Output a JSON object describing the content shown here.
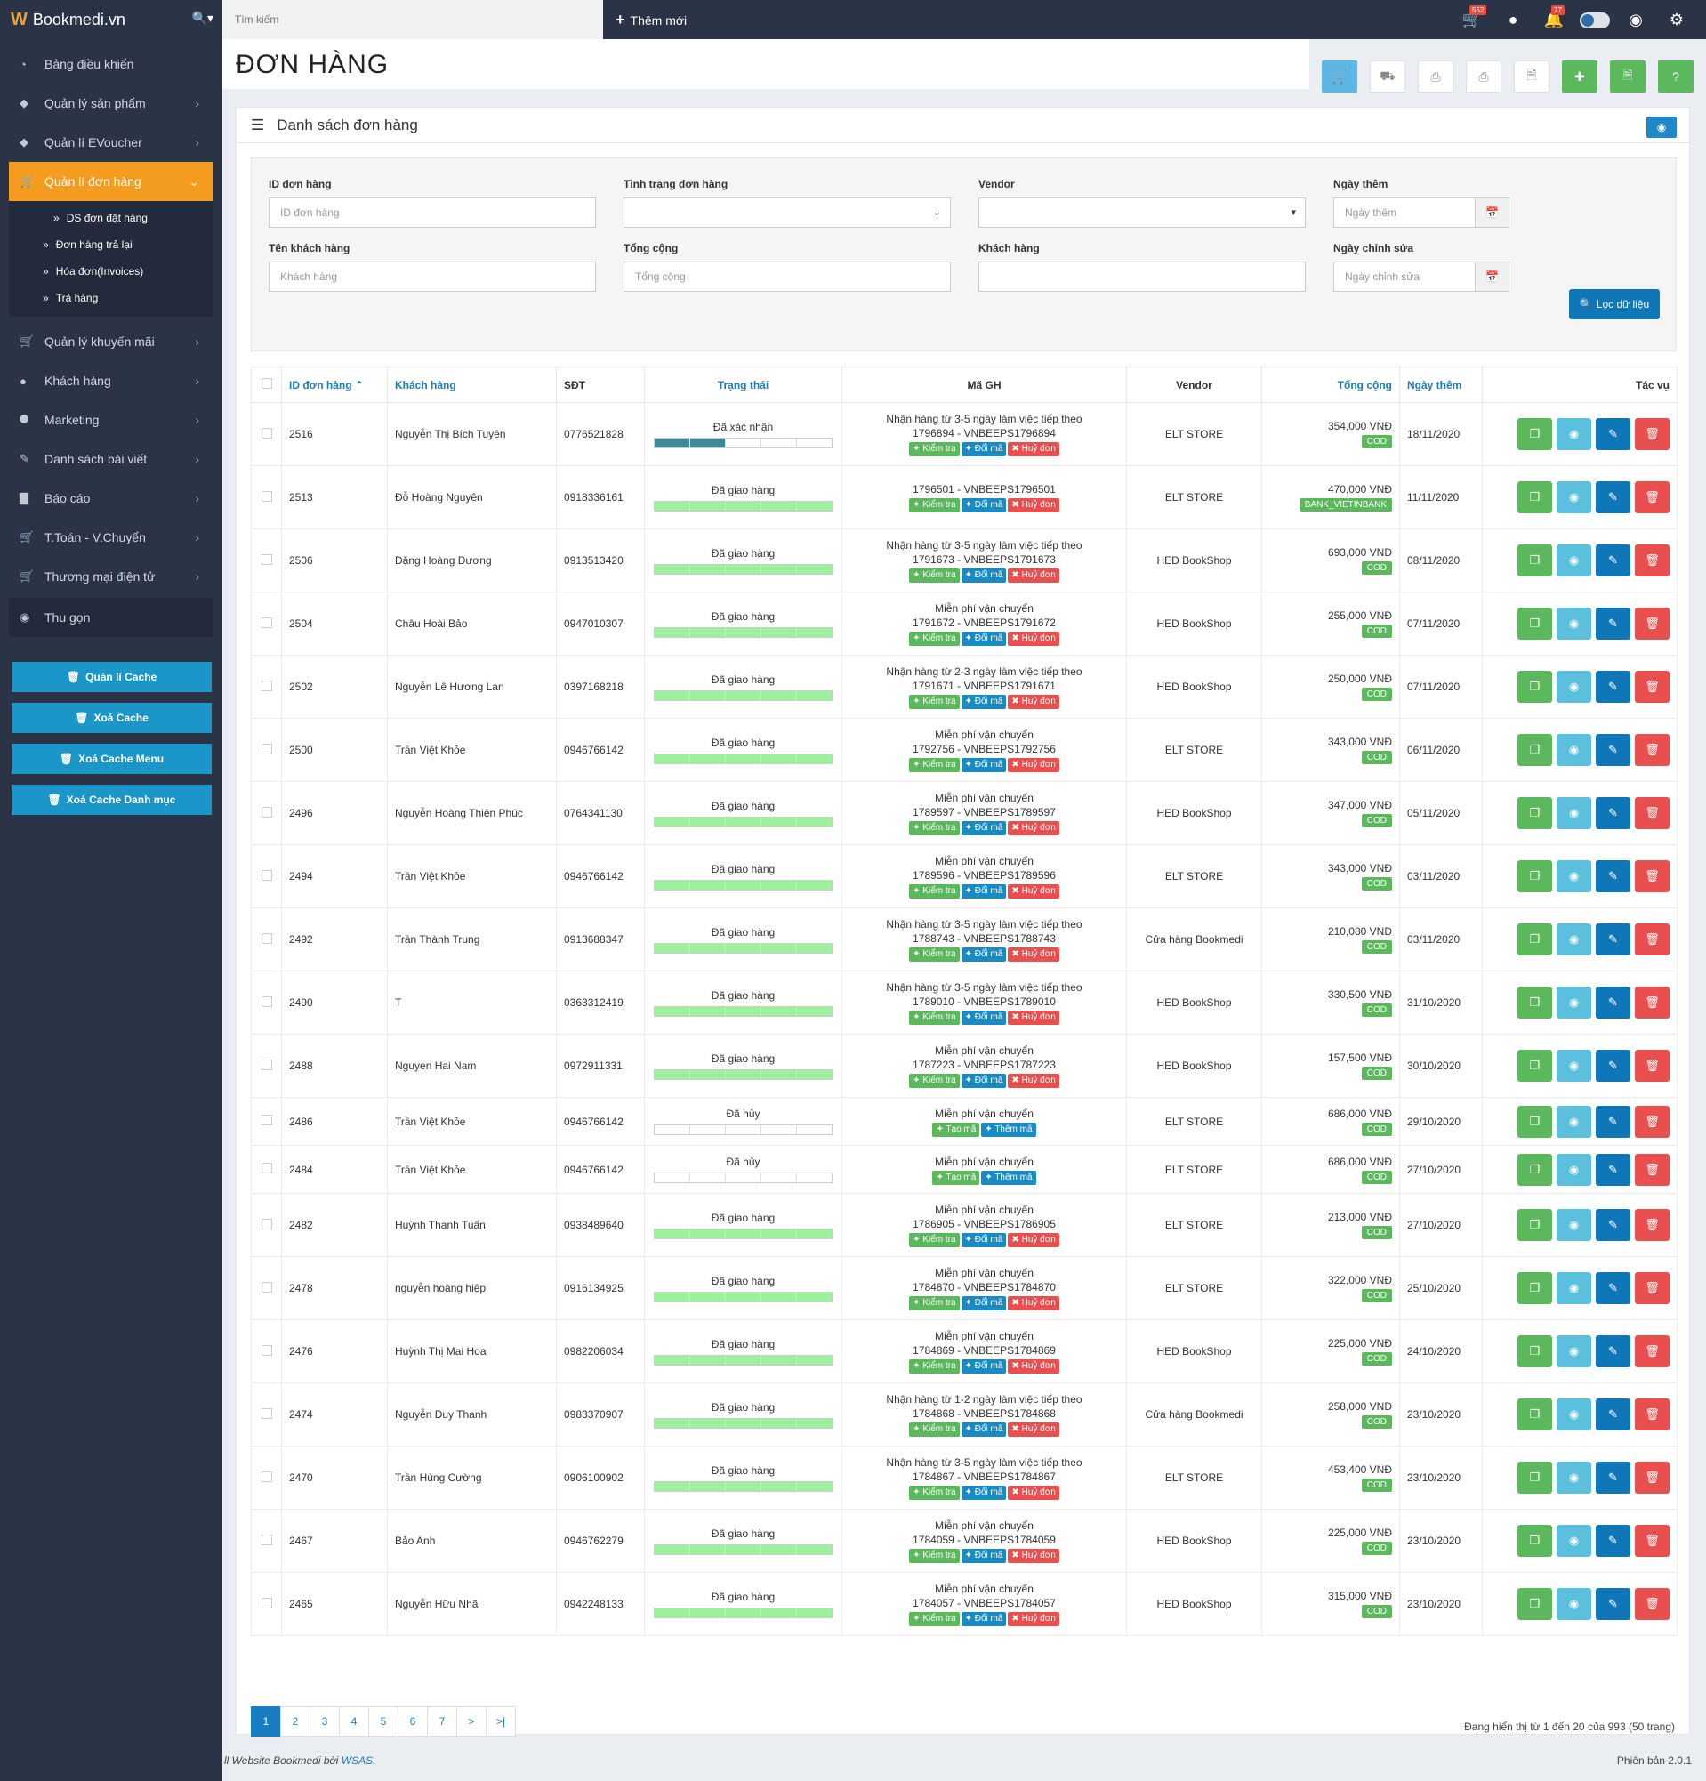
{
  "brand": {
    "name": "Bookmedi.vn"
  },
  "topbar": {
    "search_placeholder": "Tìm kiếm",
    "add_new": "Thêm mới",
    "cart_count": "552",
    "bell_count": "77"
  },
  "sidebar": {
    "items": [
      {
        "label": "Bảng điều khiển",
        "icon": "dashboard-icon"
      },
      {
        "label": "Quản lý sản phẩm",
        "icon": "tags-icon"
      },
      {
        "label": "Quản lí EVoucher",
        "icon": "tags-icon"
      },
      {
        "label": "Quản lí đơn hàng",
        "icon": "cart-icon"
      }
    ],
    "sub": [
      "DS đơn đặt hàng",
      "Đơn hàng trả lại",
      "Hóa đơn(Invoices)",
      "Trả hàng"
    ],
    "items2": [
      {
        "label": "Quản lý khuyến mãi",
        "icon": "cart-icon"
      },
      {
        "label": "Khách hàng",
        "icon": "user-icon"
      },
      {
        "label": "Marketing",
        "icon": "share-icon"
      },
      {
        "label": "Danh sách bài viết",
        "icon": "pencil-icon"
      },
      {
        "label": "Báo cáo",
        "icon": "chart-icon"
      },
      {
        "label": "T.Toán - V.Chuyển",
        "icon": "cart-icon"
      },
      {
        "label": "Thương mại điện tử",
        "icon": "cart-icon"
      }
    ],
    "collapse": "Thu gọn",
    "cache_buttons": [
      "Quản lí Cache",
      "Xoá Cache",
      "Xoá Cache Menu",
      "Xoá Cache Danh mục"
    ]
  },
  "page": {
    "title": "ĐƠN HÀNG",
    "panel_title": "Danh sách đơn hàng"
  },
  "filter": {
    "order_id_label": "ID đơn hàng",
    "order_id_placeholder": "ID đơn hàng",
    "status_label": "Tình trạng đơn hàng",
    "vendor_label": "Vendor",
    "date_added_label": "Ngày thêm",
    "date_added_placeholder": "Ngày thêm",
    "customer_name_label": "Tên khách hàng",
    "customer_name_placeholder": "Khách hàng",
    "total_label": "Tổng cộng",
    "total_placeholder": "Tổng cộng",
    "customer_label": "Khách hàng",
    "date_modified_label": "Ngày chỉnh sửa",
    "date_modified_placeholder": "Ngày chỉnh sửa",
    "button": "Lọc dữ liệu"
  },
  "table": {
    "headers": [
      "ID đơn hàng",
      "Khách hàng",
      "SĐT",
      "Trạng thái",
      "Mã GH",
      "Vendor",
      "Tổng cộng",
      "Ngày thêm",
      "Tác vụ"
    ],
    "btn_check": "Kiểm tra",
    "btn_change": "Đổi mã",
    "btn_cancel": "Huỷ đơn",
    "btn_create": "Tạo mã",
    "btn_add": "Thêm mã",
    "rows": [
      {
        "id": "2516",
        "name": "Nguyễn Thị Bích Tuyền",
        "phone": "0776521828",
        "status": "Đã xác nhận",
        "progress": 0.33,
        "ship_note": "Nhận hàng từ 3-5 ngày làm việc tiếp theo",
        "code": "1796894 - VNBEEPS1796894",
        "vendor": "ELT STORE",
        "total": "354,000 VNĐ",
        "pay": "COD",
        "date": "18/11/2020"
      },
      {
        "id": "2513",
        "name": "Đỗ Hoàng Nguyên",
        "phone": "0918336161",
        "status": "Đã giao hàng",
        "progress": 1,
        "ship_note": "",
        "code": "1796501 - VNBEEPS1796501",
        "vendor": "ELT STORE",
        "total": "470,000 VNĐ",
        "pay": "BANK_VIETINBANK",
        "date": "11/11/2020"
      },
      {
        "id": "2506",
        "name": "Đặng Hoàng Dương",
        "phone": "0913513420",
        "status": "Đã giao hàng",
        "progress": 1,
        "ship_note": "Nhận hàng từ 3-5 ngày làm việc tiếp theo",
        "code": "1791673 - VNBEEPS1791673",
        "vendor": "HED BookShop",
        "total": "693,000 VNĐ",
        "pay": "COD",
        "date": "08/11/2020"
      },
      {
        "id": "2504",
        "name": "Châu Hoài Bảo",
        "phone": "0947010307",
        "status": "Đã giao hàng",
        "progress": 1,
        "ship_note": "Miễn phí vận chuyển",
        "code": "1791672 - VNBEEPS1791672",
        "vendor": "HED BookShop",
        "total": "255,000 VNĐ",
        "pay": "COD",
        "date": "07/11/2020"
      },
      {
        "id": "2502",
        "name": "Nguyễn Lê Hương Lan",
        "phone": "0397168218",
        "status": "Đã giao hàng",
        "progress": 1,
        "ship_note": "Nhận hàng từ 2-3 ngày làm việc tiếp theo",
        "code": "1791671 - VNBEEPS1791671",
        "vendor": "HED BookShop",
        "total": "250,000 VNĐ",
        "pay": "COD",
        "date": "07/11/2020"
      },
      {
        "id": "2500",
        "name": "Trần Việt Khỏe",
        "phone": "0946766142",
        "status": "Đã giao hàng",
        "progress": 1,
        "ship_note": "Miễn phí vận chuyển",
        "code": "1792756 - VNBEEPS1792756",
        "vendor": "ELT STORE",
        "total": "343,000 VNĐ",
        "pay": "COD",
        "date": "06/11/2020"
      },
      {
        "id": "2496",
        "name": "Nguyễn Hoàng Thiên Phúc",
        "phone": "0764341130",
        "status": "Đã giao hàng",
        "progress": 1,
        "ship_note": "Miễn phí vận chuyển",
        "code": "1789597 - VNBEEPS1789597",
        "vendor": "HED BookShop",
        "total": "347,000 VNĐ",
        "pay": "COD",
        "date": "05/11/2020"
      },
      {
        "id": "2494",
        "name": "Trần Việt Khỏe",
        "phone": "0946766142",
        "status": "Đã giao hàng",
        "progress": 1,
        "ship_note": "Miễn phí vận chuyển",
        "code": "1789596 - VNBEEPS1789596",
        "vendor": "ELT STORE",
        "total": "343,000 VNĐ",
        "pay": "COD",
        "date": "03/11/2020"
      },
      {
        "id": "2492",
        "name": "Trần Thành Trung",
        "phone": "0913688347",
        "status": "Đã giao hàng",
        "progress": 1,
        "ship_note": "Nhận hàng từ 3-5 ngày làm việc tiếp theo",
        "code": "1788743 - VNBEEPS1788743",
        "vendor": "Cửa hàng Bookmedi",
        "total": "210,080 VNĐ",
        "pay": "COD",
        "date": "03/11/2020"
      },
      {
        "id": "2490",
        "name": "T",
        "phone": "0363312419",
        "status": "Đã giao hàng",
        "progress": 1,
        "ship_note": "Nhận hàng từ 3-5 ngày làm việc tiếp theo",
        "code": "1789010 - VNBEEPS1789010",
        "vendor": "HED BookShop",
        "total": "330,500 VNĐ",
        "pay": "COD",
        "date": "31/10/2020"
      },
      {
        "id": "2488",
        "name": "Nguyen Hai Nam",
        "phone": "0972911331",
        "status": "Đã giao hàng",
        "progress": 1,
        "ship_note": "Miễn phí vận chuyển",
        "code": "1787223 - VNBEEPS1787223",
        "vendor": "HED BookShop",
        "total": "157,500 VNĐ",
        "pay": "COD",
        "date": "30/10/2020"
      },
      {
        "id": "2486",
        "name": "Trần Việt Khỏe",
        "phone": "0946766142",
        "status": "Đã hủy",
        "progress": 0,
        "ship_note": "Miễn phí vận chuyển",
        "code": "",
        "vendor": "ELT STORE",
        "total": "686,000 VNĐ",
        "pay": "COD",
        "date": "29/10/2020"
      },
      {
        "id": "2484",
        "name": "Trần Việt Khỏe",
        "phone": "0946766142",
        "status": "Đã hủy",
        "progress": 0,
        "ship_note": "Miễn phí vận chuyển",
        "code": "",
        "vendor": "ELT STORE",
        "total": "686,000 VNĐ",
        "pay": "COD",
        "date": "27/10/2020"
      },
      {
        "id": "2482",
        "name": "Huỳnh Thanh Tuấn",
        "phone": "0938489640",
        "status": "Đã giao hàng",
        "progress": 1,
        "ship_note": "Miễn phí vận chuyển",
        "code": "1786905 - VNBEEPS1786905",
        "vendor": "ELT STORE",
        "total": "213,000 VNĐ",
        "pay": "COD",
        "date": "27/10/2020"
      },
      {
        "id": "2478",
        "name": "nguyễn hoàng hiệp",
        "phone": "0916134925",
        "status": "Đã giao hàng",
        "progress": 1,
        "ship_note": "Miễn phí vận chuyển",
        "code": "1784870 - VNBEEPS1784870",
        "vendor": "ELT STORE",
        "total": "322,000 VNĐ",
        "pay": "COD",
        "date": "25/10/2020"
      },
      {
        "id": "2476",
        "name": "Huỳnh Thị Mai Hoa",
        "phone": "0982206034",
        "status": "Đã giao hàng",
        "progress": 1,
        "ship_note": "Miễn phí vận chuyển",
        "code": "1784869 - VNBEEPS1784869",
        "vendor": "HED BookShop",
        "total": "225,000 VNĐ",
        "pay": "COD",
        "date": "24/10/2020"
      },
      {
        "id": "2474",
        "name": "Nguyễn Duy Thanh",
        "phone": "0983370907",
        "status": "Đã giao hàng",
        "progress": 1,
        "ship_note": "Nhận hàng từ 1-2 ngày làm việc tiếp theo",
        "code": "1784868 - VNBEEPS1784868",
        "vendor": "Cửa hàng Bookmedi",
        "total": "258,000 VNĐ",
        "pay": "COD",
        "date": "23/10/2020"
      },
      {
        "id": "2470",
        "name": "Trần Hùng Cường",
        "phone": "0906100902",
        "status": "Đã giao hàng",
        "progress": 1,
        "ship_note": "Nhận hàng từ 3-5 ngày làm việc tiếp theo",
        "code": "1784867 - VNBEEPS1784867",
        "vendor": "ELT STORE",
        "total": "453,400 VNĐ",
        "pay": "COD",
        "date": "23/10/2020"
      },
      {
        "id": "2467",
        "name": "Bảo Anh",
        "phone": "0946762279",
        "status": "Đã giao hàng",
        "progress": 1,
        "ship_note": "Miễn phí vận chuyển",
        "code": "1784059 - VNBEEPS1784059",
        "vendor": "HED BookShop",
        "total": "225,000 VNĐ",
        "pay": "COD",
        "date": "23/10/2020"
      },
      {
        "id": "2465",
        "name": "Nguyễn Hữu Nhã",
        "phone": "0942248133",
        "status": "Đã giao hàng",
        "progress": 1,
        "ship_note": "Miễn phí vận chuyển",
        "code": "1784057 - VNBEEPS1784057",
        "vendor": "HED BookShop",
        "total": "315,000 VNĐ",
        "pay": "COD",
        "date": "23/10/2020"
      }
    ]
  },
  "pagination": {
    "pages": [
      "1",
      "2",
      "3",
      "4",
      "5",
      "6",
      "7",
      ">",
      ">|"
    ],
    "current": "1",
    "showing": "Đang hiển thị từ 1 đến 20 của 993 (50 trang)"
  },
  "footer": {
    "left_prefix": "ll Website Bookmedi bởi ",
    "left_link": "WSAS.",
    "right": "Phiên bản 2.0.1"
  },
  "colors": {
    "accent": "#f39c1f",
    "primary": "#1a96c9",
    "success": "#5cb85c",
    "danger": "#e94f4f",
    "sidebar": "#2b3347"
  }
}
